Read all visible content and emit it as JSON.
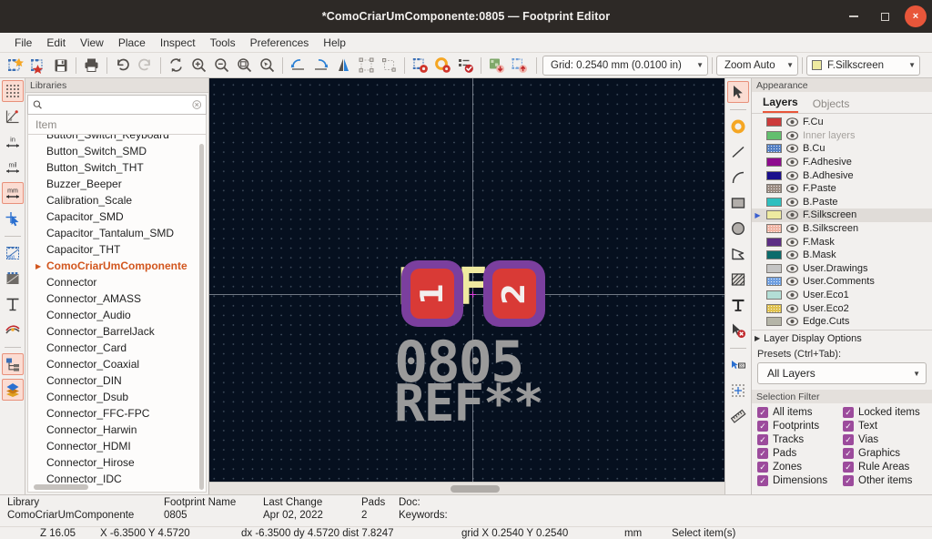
{
  "window": {
    "title": "*ComoCriarUmComponente:0805 — Footprint Editor",
    "minimize_label": "Minimize",
    "maximize_label": "Restore",
    "close_label": "×"
  },
  "menubar": {
    "items": [
      "File",
      "Edit",
      "View",
      "Place",
      "Inspect",
      "Tools",
      "Preferences",
      "Help"
    ]
  },
  "toolbar": {
    "buttons": [
      {
        "name": "new-footprint-icon",
        "tip": "New footprint"
      },
      {
        "name": "new-footprint-from-wizard-icon",
        "tip": "Create footprint using wizard"
      },
      {
        "name": "save-icon",
        "tip": "Save"
      },
      {
        "name": "print-icon",
        "tip": "Print"
      },
      {
        "name": "undo-icon",
        "tip": "Undo"
      },
      {
        "name": "redo-icon",
        "tip": "Redo"
      },
      {
        "name": "refresh-icon",
        "tip": "Refresh"
      },
      {
        "name": "zoom-in-icon",
        "tip": "Zoom in"
      },
      {
        "name": "zoom-out-icon",
        "tip": "Zoom out"
      },
      {
        "name": "zoom-fit-icon",
        "tip": "Zoom to fit"
      },
      {
        "name": "zoom-area-icon",
        "tip": "Zoom to selection"
      },
      {
        "name": "rotate-ccw-icon",
        "tip": "Rotate counterclockwise"
      },
      {
        "name": "rotate-cw-icon",
        "tip": "Rotate clockwise"
      },
      {
        "name": "mirror-icon",
        "tip": "Mirror"
      },
      {
        "name": "group-icon",
        "tip": "Group items"
      },
      {
        "name": "ungroup-icon",
        "tip": "Ungroup items"
      },
      {
        "name": "footprint-properties-icon",
        "tip": "Footprint properties"
      },
      {
        "name": "default-pad-properties-icon",
        "tip": "Default pad properties"
      },
      {
        "name": "check-footprint-icon",
        "tip": "Check footprint"
      },
      {
        "name": "load-footprint-from-board-icon",
        "tip": "Load footprint from board"
      },
      {
        "name": "insert-footprint-to-board-icon",
        "tip": "Insert footprint into board"
      }
    ],
    "grid_label": "Grid: 0.2540 mm (0.0100 in)",
    "zoom_label": "Zoom Auto",
    "active_layer_label": "F.Silkscreen",
    "active_layer_color": "#eeeaa0"
  },
  "left_toolbar": {
    "buttons": [
      {
        "name": "toggle-grid-icon",
        "active": true,
        "tip": "Show grid"
      },
      {
        "name": "polar-coordinates-icon",
        "active": false,
        "tip": "Polar coordinates"
      },
      {
        "name": "units-inches-icon",
        "active": false,
        "label": "in",
        "tip": "Inches"
      },
      {
        "name": "units-mils-icon",
        "active": false,
        "label": "mil",
        "tip": "Mils"
      },
      {
        "name": "units-millimeters-icon",
        "active": true,
        "label": "mm",
        "tip": "Millimeters"
      },
      {
        "name": "full-crosshair-icon",
        "active": false,
        "tip": "Full-window crosshair"
      },
      {
        "name": "pads-sketch-mode-icon",
        "active": false,
        "tip": "Show pads in outline mode"
      },
      {
        "name": "graphics-sketch-mode-icon",
        "active": false,
        "tip": "Show graphics in outline mode"
      },
      {
        "name": "text-sketch-mode-icon",
        "active": false,
        "tip": "Show text in outline mode"
      },
      {
        "name": "high-contrast-mode-icon",
        "active": false,
        "tip": "High contrast mode"
      },
      {
        "name": "toggle-library-tree-icon",
        "active": true,
        "tip": "Show footprint tree"
      },
      {
        "name": "toggle-appearance-panel-icon",
        "active": true,
        "tip": "Show appearance manager"
      }
    ]
  },
  "right_toolbar": {
    "buttons": [
      {
        "name": "select-tool-icon",
        "active": true,
        "tip": "Select item"
      },
      {
        "name": "add-pad-icon",
        "active": false,
        "tip": "Add pad"
      },
      {
        "name": "draw-line-icon",
        "active": false,
        "tip": "Draw line"
      },
      {
        "name": "draw-arc-icon",
        "active": false,
        "tip": "Draw arc"
      },
      {
        "name": "draw-rectangle-icon",
        "active": false,
        "tip": "Draw rectangle"
      },
      {
        "name": "draw-circle-icon",
        "active": false,
        "tip": "Draw circle"
      },
      {
        "name": "draw-polygon-icon",
        "active": false,
        "tip": "Draw polygon"
      },
      {
        "name": "add-rule-area-icon",
        "active": false,
        "tip": "Add rule area"
      },
      {
        "name": "add-text-icon",
        "active": false,
        "tip": "Add text"
      },
      {
        "name": "delete-tool-icon",
        "active": false,
        "tip": "Delete items"
      },
      {
        "name": "set-anchor-icon",
        "active": false,
        "tip": "Set anchor position"
      },
      {
        "name": "set-origin-icon",
        "active": false,
        "tip": "Set grid origin"
      },
      {
        "name": "measure-tool-icon",
        "active": false,
        "tip": "Measure distance"
      }
    ]
  },
  "libraries_panel": {
    "header": "Libraries",
    "search_value": "",
    "search_placeholder": "",
    "column_header": "Item",
    "items": [
      {
        "label": "Button_Switch_Keyboard",
        "highlight": false,
        "expandable": false
      },
      {
        "label": "Button_Switch_SMD",
        "highlight": false,
        "expandable": false
      },
      {
        "label": "Button_Switch_THT",
        "highlight": false,
        "expandable": false
      },
      {
        "label": "Buzzer_Beeper",
        "highlight": false,
        "expandable": false
      },
      {
        "label": "Calibration_Scale",
        "highlight": false,
        "expandable": false
      },
      {
        "label": "Capacitor_SMD",
        "highlight": false,
        "expandable": false
      },
      {
        "label": "Capacitor_Tantalum_SMD",
        "highlight": false,
        "expandable": false
      },
      {
        "label": "Capacitor_THT",
        "highlight": false,
        "expandable": false
      },
      {
        "label": "ComoCriarUmComponente",
        "highlight": true,
        "expandable": true
      },
      {
        "label": "Connector",
        "highlight": false,
        "expandable": false
      },
      {
        "label": "Connector_AMASS",
        "highlight": false,
        "expandable": false
      },
      {
        "label": "Connector_Audio",
        "highlight": false,
        "expandable": false
      },
      {
        "label": "Connector_BarrelJack",
        "highlight": false,
        "expandable": false
      },
      {
        "label": "Connector_Card",
        "highlight": false,
        "expandable": false
      },
      {
        "label": "Connector_Coaxial",
        "highlight": false,
        "expandable": false
      },
      {
        "label": "Connector_DIN",
        "highlight": false,
        "expandable": false
      },
      {
        "label": "Connector_Dsub",
        "highlight": false,
        "expandable": false
      },
      {
        "label": "Connector_FFC-FPC",
        "highlight": false,
        "expandable": false
      },
      {
        "label": "Connector_Harwin",
        "highlight": false,
        "expandable": false
      },
      {
        "label": "Connector_HDMI",
        "highlight": false,
        "expandable": false
      },
      {
        "label": "Connector_Hirose",
        "highlight": false,
        "expandable": false
      },
      {
        "label": "Connector_IDC",
        "highlight": false,
        "expandable": false
      }
    ]
  },
  "canvas": {
    "reference_text": "REF**",
    "value_text": "0805",
    "user_text": "REF**",
    "pads": [
      {
        "number": "1"
      },
      {
        "number": "2"
      }
    ],
    "background_color": "#06101f",
    "silkscreen_color": "#efeaa0",
    "pad_copper_color": "#d93a36",
    "pad_mask_color": "#7b3f9e",
    "user_layer_color": "#9a9a9a"
  },
  "appearance": {
    "header": "Appearance",
    "tabs": [
      {
        "label": "Layers",
        "active": true
      },
      {
        "label": "Objects",
        "active": false
      }
    ],
    "layers": [
      {
        "label": "F.Cu",
        "color": "#cc3a3a",
        "selected": false,
        "dim": false,
        "dotted": false
      },
      {
        "label": "Inner layers",
        "color": "#62bf6e",
        "selected": false,
        "dim": true,
        "dotted": false
      },
      {
        "label": "B.Cu",
        "color": "#5580c4",
        "selected": false,
        "dim": false,
        "dotted": true
      },
      {
        "label": "F.Adhesive",
        "color": "#8e0a8e",
        "selected": false,
        "dim": false,
        "dotted": false
      },
      {
        "label": "B.Adhesive",
        "color": "#1a0f8c",
        "selected": false,
        "dim": false,
        "dotted": false
      },
      {
        "label": "F.Paste",
        "color": "#9c8d84",
        "selected": false,
        "dim": false,
        "dotted": true
      },
      {
        "label": "B.Paste",
        "color": "#2fbfbf",
        "selected": false,
        "dim": false,
        "dotted": false
      },
      {
        "label": "F.Silkscreen",
        "color": "#eeeaa0",
        "selected": true,
        "dim": false,
        "dotted": false
      },
      {
        "label": "B.Silkscreen",
        "color": "#f0b5a5",
        "selected": false,
        "dim": false,
        "dotted": true
      },
      {
        "label": "F.Mask",
        "color": "#5c2d84",
        "selected": false,
        "dim": false,
        "dotted": false
      },
      {
        "label": "B.Mask",
        "color": "#0c6b6b",
        "selected": false,
        "dim": false,
        "dotted": false
      },
      {
        "label": "User.Drawings",
        "color": "#c4c4c4",
        "selected": false,
        "dim": false,
        "dotted": false
      },
      {
        "label": "User.Comments",
        "color": "#6f9fe0",
        "selected": false,
        "dim": false,
        "dotted": true
      },
      {
        "label": "User.Eco1",
        "color": "#b3ded6",
        "selected": false,
        "dim": false,
        "dotted": false
      },
      {
        "label": "User.Eco2",
        "color": "#e0c24f",
        "selected": false,
        "dim": false,
        "dotted": true
      },
      {
        "label": "Edge.Cuts",
        "color": "#b5b5a8",
        "selected": false,
        "dim": false,
        "dotted": false
      }
    ],
    "layer_display_options": "Layer Display Options",
    "presets_label": "Presets (Ctrl+Tab):",
    "presets_value": "All Layers",
    "selection_filter": {
      "header": "Selection Filter",
      "items": [
        {
          "label": "All items",
          "checked": true
        },
        {
          "label": "Locked items",
          "checked": true
        },
        {
          "label": "Footprints",
          "checked": true
        },
        {
          "label": "Text",
          "checked": true
        },
        {
          "label": "Tracks",
          "checked": true
        },
        {
          "label": "Vias",
          "checked": true
        },
        {
          "label": "Pads",
          "checked": true
        },
        {
          "label": "Graphics",
          "checked": true
        },
        {
          "label": "Zones",
          "checked": true
        },
        {
          "label": "Rule Areas",
          "checked": true
        },
        {
          "label": "Dimensions",
          "checked": true
        },
        {
          "label": "Other items",
          "checked": true
        }
      ]
    }
  },
  "status": {
    "library_label": "Library",
    "library_value": "ComoCriarUmComponente",
    "footprint_name_label": "Footprint Name",
    "footprint_name_value": "0805",
    "last_change_label": "Last Change",
    "last_change_value": "Apr 02, 2022",
    "pads_label": "Pads",
    "pads_value": "2",
    "doc_label": "Doc:",
    "keywords_label": "Keywords:",
    "zoom_value": "Z 16.05",
    "cursor_xy": "X -6.3500  Y 4.5720",
    "delta_xy": "dx -6.3500  dy 4.5720  dist 7.8247",
    "grid_value": "grid X 0.2540  Y 0.2540",
    "units_value": "mm",
    "message_value": "Select item(s)"
  }
}
